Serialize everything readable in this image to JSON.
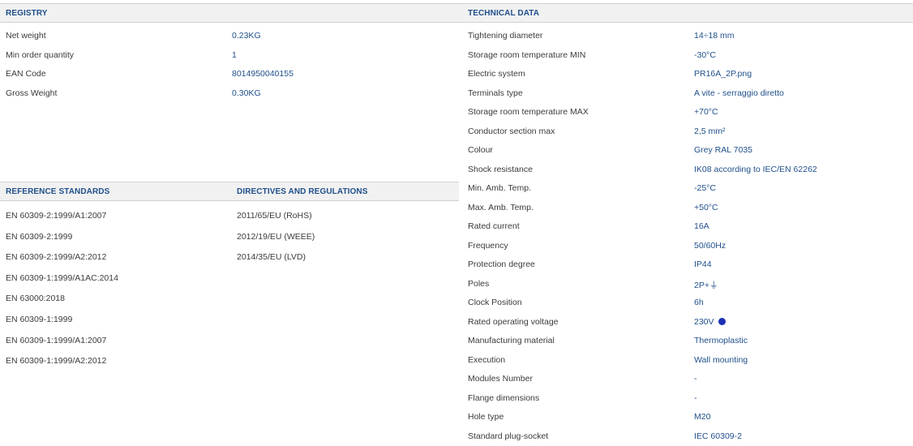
{
  "registry": {
    "header": "REGISTRY",
    "rows": [
      {
        "label": "Net weight",
        "value": "0.23KG"
      },
      {
        "label": "Min order quantity",
        "value": "1"
      },
      {
        "label": "EAN Code",
        "value": "8014950040155"
      },
      {
        "label": "Gross Weight",
        "value": "0.30KG"
      }
    ]
  },
  "technical": {
    "header": "TECHNICAL DATA",
    "rows": [
      {
        "label": "Tightening diameter",
        "value": "14÷18 mm"
      },
      {
        "label": "Storage room temperature MIN",
        "value": "-30°C"
      },
      {
        "label": "Electric system",
        "value": "PR16A_2P.png"
      },
      {
        "label": "Terminals type",
        "value": "A vite - serraggio diretto"
      },
      {
        "label": "Storage room temperature MAX",
        "value": "+70°C"
      },
      {
        "label": "Conductor section max",
        "value": "2,5 mm²"
      },
      {
        "label": "Colour",
        "value": "Grey RAL 7035"
      },
      {
        "label": "Shock resistance",
        "value": "IK08 according to IEC/EN 62262"
      },
      {
        "label": "Min. Amb. Temp.",
        "value": "-25°C"
      },
      {
        "label": "Max. Amb. Temp.",
        "value": "+50°C"
      },
      {
        "label": "Rated current",
        "value": "16A"
      },
      {
        "label": "Frequency",
        "value": "50/60Hz"
      },
      {
        "label": "Protection degree",
        "value": "IP44"
      },
      {
        "label": "Poles",
        "value": "2P+⏚"
      },
      {
        "label": "Clock Position",
        "value": "6h"
      },
      {
        "label": "Rated operating voltage",
        "value": "230V"
      },
      {
        "label": "Manufacturing material",
        "value": "Thermoplastic"
      },
      {
        "label": "Execution",
        "value": "Wall mounting"
      },
      {
        "label": "Modules Number",
        "value": "-"
      },
      {
        "label": "Flange dimensions",
        "value": "-"
      },
      {
        "label": "Hole type",
        "value": "M20"
      },
      {
        "label": "Standard plug-socket",
        "value": "IEC 60309-2"
      }
    ]
  },
  "standards": {
    "header": "REFERENCE STANDARDS",
    "items": [
      "EN 60309-2:1999/A1:2007",
      "EN 60309-2:1999",
      "EN 60309-2:1999/A2:2012",
      "EN 60309-1:1999/A1AC:2014",
      "EN 63000:2018",
      "EN 60309-1:1999",
      "EN 60309-1:1999/A1:2007",
      "EN 60309-1:1999/A2:2012"
    ]
  },
  "directives": {
    "header": "DIRECTIVES AND REGULATIONS",
    "items": [
      "2011/65/EU (RoHS)",
      "2012/19/EU (WEEE)",
      "2014/35/EU (LVD)"
    ]
  },
  "colors": {
    "header_text": "#1f4f8a",
    "value_text": "#1f4f8a",
    "header_bg": "#f1f1f1",
    "voltage_dot": "#1d2fb8"
  }
}
